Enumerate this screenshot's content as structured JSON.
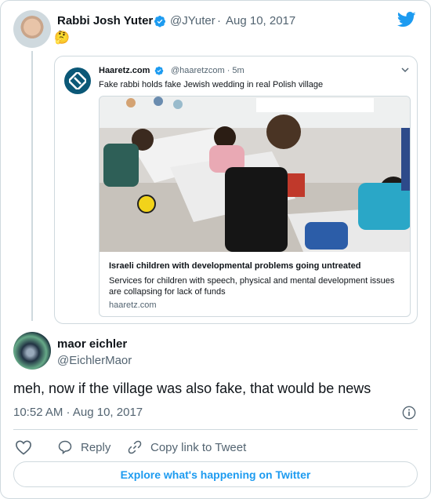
{
  "parent": {
    "name": "Rabbi Josh Yuter",
    "handle": "@JYuter",
    "date_sep": "·",
    "date": "Aug 10, 2017",
    "emoji": "🤔"
  },
  "quoted": {
    "name": "Haaretz.com",
    "handle": "@haaretzcom · 5m",
    "text": "Fake rabbi holds fake Jewish wedding in real Polish village",
    "card": {
      "title": "Israeli children with developmental problems going untreated",
      "description": "Services for children with speech, physical and mental development issues are collapsing for lack of funds",
      "domain": "haaretz.com"
    }
  },
  "reply": {
    "name": "maor eichler",
    "handle": "@EichlerMaor",
    "text": "meh, now if the village was also fake, that would be news",
    "timestamp": "10:52 AM · Aug 10, 2017"
  },
  "actions": {
    "reply_label": "Reply",
    "copy_label": "Copy link to Tweet",
    "explore_label": "Explore what's happening on Twitter"
  },
  "colors": {
    "twitter_blue": "#1d9bf0",
    "text": "#0f1419",
    "secondary": "#536471",
    "border": "#cfd9de",
    "haaretz_blue": "#0b5877"
  },
  "icons": [
    "verified-icon",
    "twitter-logo-icon",
    "chevron-down-icon",
    "info-icon",
    "heart-icon",
    "reply-icon",
    "link-icon"
  ]
}
